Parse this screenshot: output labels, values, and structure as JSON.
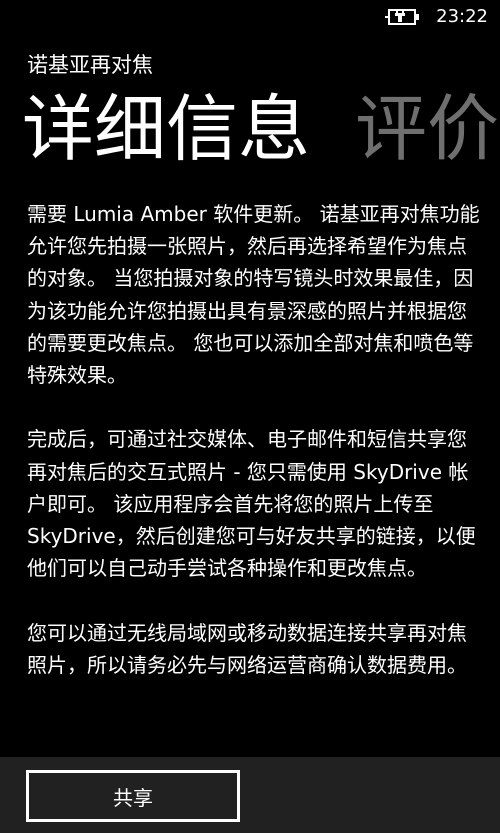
{
  "status_bar": {
    "time": "23:22",
    "icon": "battery-charging-icon"
  },
  "app": {
    "title": "诺基亚再对焦"
  },
  "pivot": {
    "active_label": "详细信息",
    "next_label": "评价"
  },
  "description": {
    "paragraphs": [
      "需要 Lumia Amber 软件更新。 诺基亚再对焦功能允许您先拍摄一张照片，然后再选择希望作为焦点的对象。 当您拍摄对象的特写镜头时效果最佳，因为该功能允许您拍摄出具有景深感的照片并根据您的需要更改焦点。 您也可以添加全部对焦和喷色等特殊效果。",
      "完成后，可通过社交媒体、电子邮件和短信共享您再对焦后的交互式照片 - 您只需使用 SkyDrive 帐户即可。 该应用程序会首先将您的照片上传至 SkyDrive，然后创建您可与好友共享的链接，以便他们可以自己动手尝试各种操作和更改焦点。",
      "您可以通过无线局域网或移动数据连接共享再对焦照片，所以请务必先与网络运营商确认数据费用。"
    ]
  },
  "app_bar": {
    "share_label": "共享"
  },
  "colors": {
    "background": "#000000",
    "text": "#ffffff",
    "inactive_pivot": "#6f6f6f",
    "app_bar": "#212121"
  }
}
